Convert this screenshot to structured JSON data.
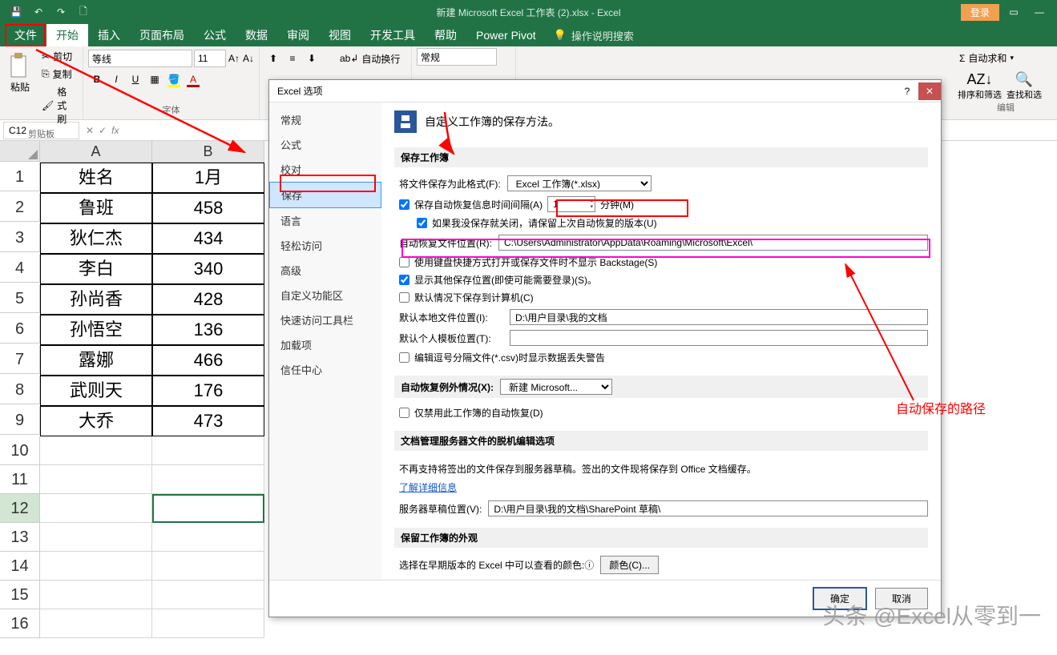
{
  "titlebar": {
    "title": "新建 Microsoft Excel 工作表 (2).xlsx - Excel",
    "login": "登录"
  },
  "ribbon": {
    "tabs": [
      "文件",
      "开始",
      "插入",
      "页面布局",
      "公式",
      "数据",
      "审阅",
      "视图",
      "开发工具",
      "帮助",
      "Power Pivot"
    ],
    "tell_me": "操作说明搜索",
    "clipboard": {
      "paste": "粘贴",
      "cut": "剪切",
      "copy": "复制",
      "format_painter": "格式刷",
      "group": "剪贴板"
    },
    "font": {
      "name": "等线",
      "size": "11",
      "group": "字体"
    },
    "alignment": {
      "wrap": "自动换行"
    },
    "number_fmt": "常规",
    "editing": {
      "autosum": "自动求和",
      "sort": "排序和筛选",
      "find": "查找和选",
      "group": "编辑"
    }
  },
  "formula_bar": {
    "cell_ref": "C12"
  },
  "grid": {
    "cols": [
      "A",
      "B"
    ],
    "rows": [
      {
        "n": 1,
        "a": "姓名",
        "b": "1月"
      },
      {
        "n": 2,
        "a": "鲁班",
        "b": "458"
      },
      {
        "n": 3,
        "a": "狄仁杰",
        "b": "434"
      },
      {
        "n": 4,
        "a": "李白",
        "b": "340"
      },
      {
        "n": 5,
        "a": "孙尚香",
        "b": "428"
      },
      {
        "n": 6,
        "a": "孙悟空",
        "b": "136"
      },
      {
        "n": 7,
        "a": "露娜",
        "b": "466"
      },
      {
        "n": 8,
        "a": "武则天",
        "b": "176"
      },
      {
        "n": 9,
        "a": "大乔",
        "b": "473"
      }
    ],
    "empty_rows": [
      10,
      11,
      12,
      13,
      14,
      15,
      16
    ]
  },
  "dialog": {
    "title": "Excel 选项",
    "nav": [
      "常规",
      "公式",
      "校对",
      "保存",
      "语言",
      "轻松访问",
      "高级",
      "自定义功能区",
      "快速访问工具栏",
      "加载项",
      "信任中心"
    ],
    "header": "自定义工作簿的保存方法。",
    "section_save": "保存工作簿",
    "save_format_label": "将文件保存为此格式(F):",
    "save_format_value": "Excel 工作簿(*.xlsx)",
    "autorecover_cb": "保存自动恢复信息时间间隔(A)",
    "autorecover_min": "1",
    "minutes": "分钟(M)",
    "keep_last_cb": "如果我没保存就关闭，请保留上次自动恢复的版本(U)",
    "autorecover_loc_label": "自动恢复文件位置(R):",
    "autorecover_loc_value": "C:\\Users\\Administrator\\AppData\\Roaming\\Microsoft\\Excel\\",
    "backstage_cb": "使用键盘快捷方式打开或保存文件时不显示 Backstage(S)",
    "show_addl_cb": "显示其他保存位置(即使可能需要登录)(S)。",
    "save_local_cb": "默认情况下保存到计算机(C)",
    "default_local_label": "默认本地文件位置(I):",
    "default_local_value": "D:\\用户目录\\我的文档",
    "default_template_label": "默认个人模板位置(T):",
    "default_template_value": "",
    "csv_cb": "编辑逗号分隔文件(*.csv)时显示数据丢失警告",
    "section_exception": "自动恢复例外情况(X):",
    "exception_value": "新建 Microsoft...",
    "disable_recover_cb": "仅禁用此工作簿的自动恢复(D)",
    "section_offline": "文档管理服务器文件的脱机编辑选项",
    "offline_text": "不再支持将签出的文件保存到服务器草稿。签出的文件现将保存到 Office 文档缓存。",
    "learn_more": "了解详细信息",
    "server_draft_label": "服务器草稿位置(V):",
    "server_draft_value": "D:\\用户目录\\我的文档\\SharePoint 草稿\\",
    "section_appearance": "保留工作簿的外观",
    "appearance_text": "选择在早期版本的 Excel 中可以查看的颜色:ⓘ",
    "color_btn": "颜色(C)...",
    "ok": "确定",
    "cancel": "取消"
  },
  "annotations": {
    "path_label": "自动保存的路径",
    "watermark": "头条 @Excel从零到一"
  }
}
